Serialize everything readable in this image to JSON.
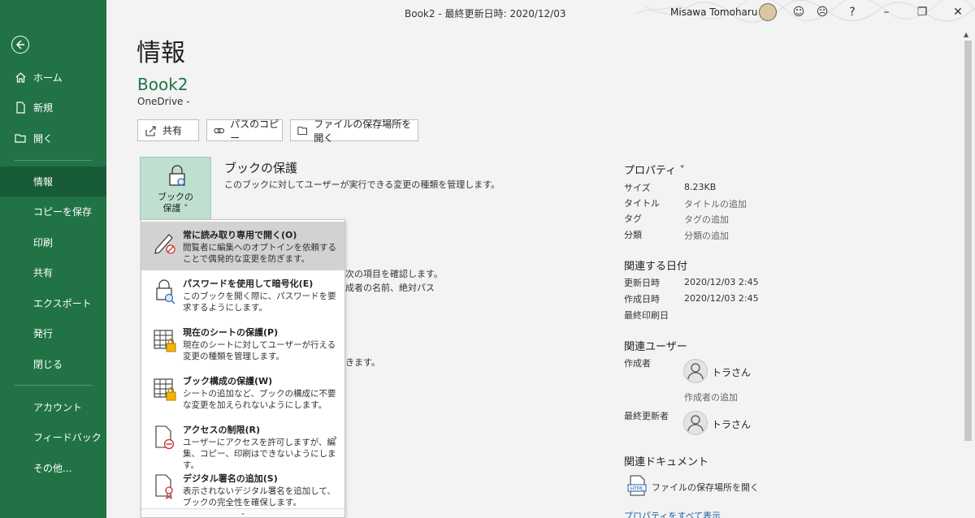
{
  "window": {
    "title": "Book2 - 最終更新日時: 2020/12/03",
    "user": "Misawa Tomoharu",
    "help": "?"
  },
  "sidebar": {
    "items": [
      {
        "label": "ホーム"
      },
      {
        "label": "新規"
      },
      {
        "label": "開く"
      },
      {
        "label": "情報"
      },
      {
        "label": "コピーを保存"
      },
      {
        "label": "印刷"
      },
      {
        "label": "共有"
      },
      {
        "label": "エクスポート"
      },
      {
        "label": "発行"
      },
      {
        "label": "閉じる"
      },
      {
        "label": "アカウント"
      },
      {
        "label": "フィードバック"
      },
      {
        "label": "その他..."
      }
    ],
    "active": "情報"
  },
  "main": {
    "page_title": "情報",
    "book_name": "Book2",
    "location": "OneDrive -",
    "buttons": {
      "share": "共有",
      "copy_path": "パスのコピー",
      "open_location": "ファイルの保存場所を開く"
    },
    "protect": {
      "tile_label_1": "ブックの",
      "tile_label_2": "保護 ˅",
      "title": "ブックの保護",
      "desc": "このブックに対してユーザーが実行できる変更の種類を管理します。"
    },
    "background_fragments": {
      "frag1": "次の項目を確認します。",
      "frag2": "成者の名前、絶対パス",
      "frag3": "きます。"
    }
  },
  "menu": {
    "items": [
      {
        "title": "常に読み取り専用で開く(O)",
        "desc": "閲覧者に編集へのオプトインを依頼することで偶発的な変更を防ぎます。"
      },
      {
        "title": "パスワードを使用して暗号化(E)",
        "desc": "このブックを開く際に、パスワードを要求するようにします。"
      },
      {
        "title": "現在のシートの保護(P)",
        "desc": "現在のシートに対してユーザーが行える変更の種類を管理します。"
      },
      {
        "title": "ブック構成の保護(W)",
        "desc": "シートの追加など、ブックの構成に不要な変更を加えられないようにします。"
      },
      {
        "title": "アクセスの制限(R)",
        "desc": "ユーザーにアクセスを許可しますが、編集、コピー、印刷はできないようにします。"
      },
      {
        "title": "デジタル署名の追加(S)",
        "desc": "表示されないデジタル署名を追加して、ブックの完全性を確保します。"
      }
    ],
    "more": "⌄"
  },
  "properties": {
    "title": "プロパティ ˅",
    "size_key": "サイズ",
    "size_val": "8.23KB",
    "title_key": "タイトル",
    "title_val": "タイトルの追加",
    "tag_key": "タグ",
    "tag_val": "タグの追加",
    "category_key": "分類",
    "category_val": "分類の追加"
  },
  "dates": {
    "title": "関連する日付",
    "modified_key": "更新日時",
    "modified_val": "2020/12/03 2:45",
    "created_key": "作成日時",
    "created_val": "2020/12/03 2:45",
    "printed_key": "最終印刷日"
  },
  "people": {
    "title": "関連ユーザー",
    "author_key": "作成者",
    "author_name": "トラさん",
    "add_author": "作成者の追加",
    "last_modified_key": "最終更新者",
    "last_modified_name": "トラさん"
  },
  "documents": {
    "title": "関連ドキュメント",
    "open_location": "ファイルの保存場所を開く",
    "html_icon_label": "HTML"
  },
  "show_all": "プロパティをすべて表示",
  "colors": {
    "sidebar": "#217346",
    "sidebar_active": "#185c37",
    "accent": "#217346",
    "link": "#1d5fa6"
  }
}
